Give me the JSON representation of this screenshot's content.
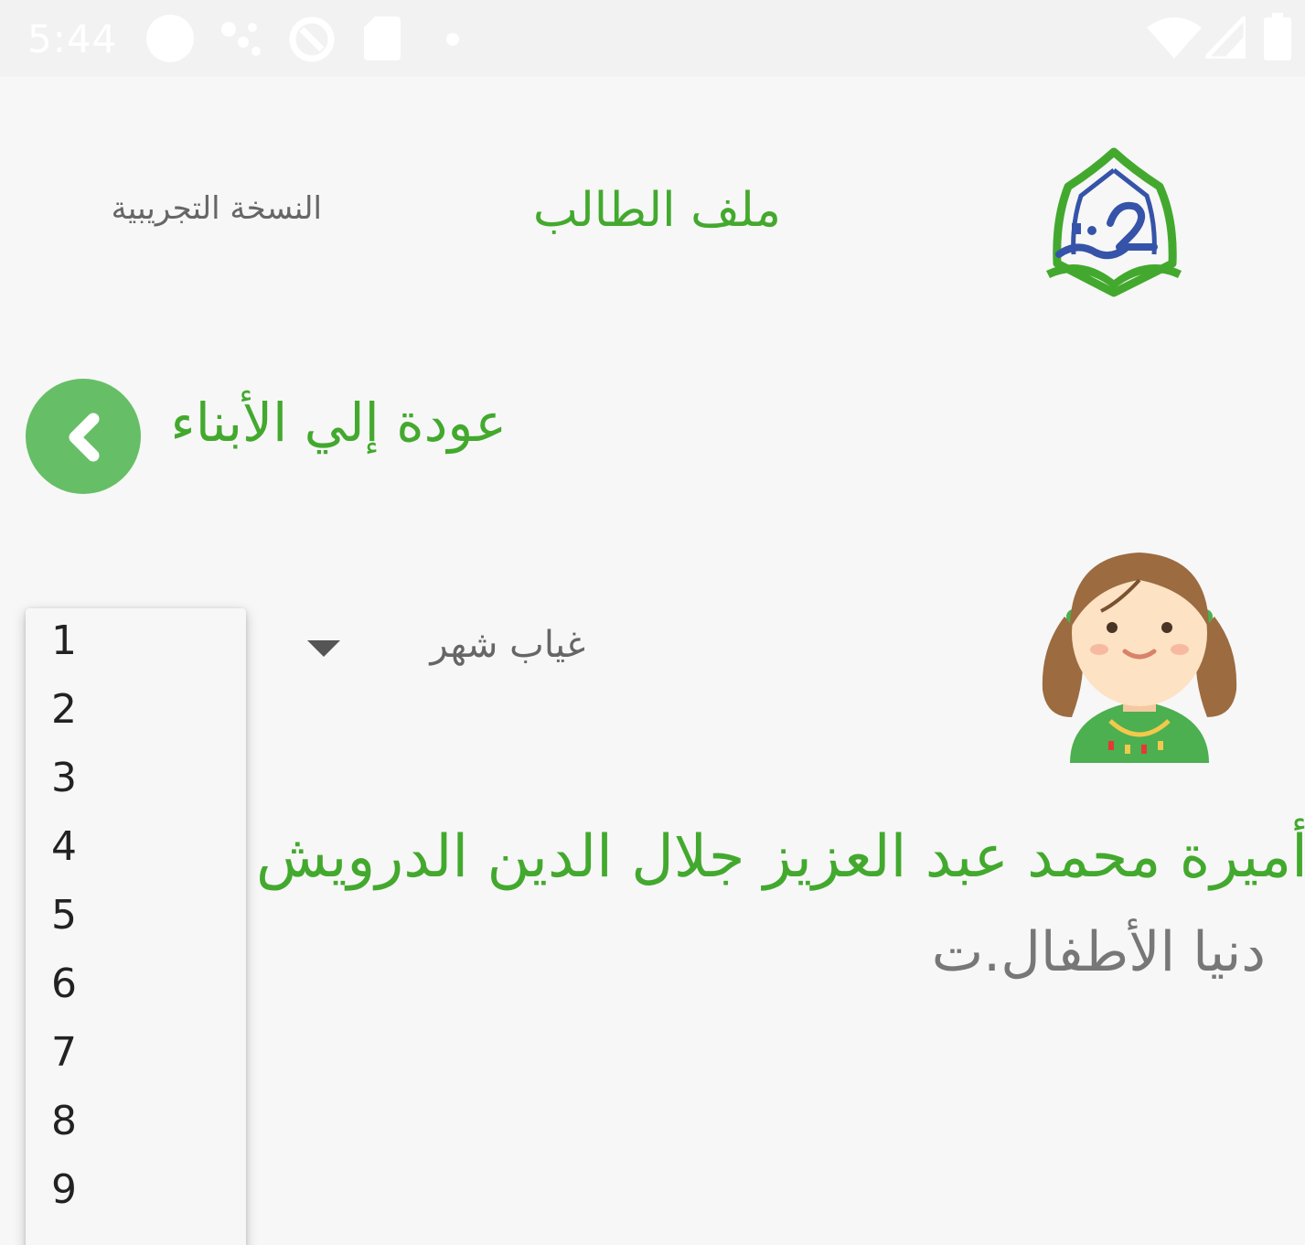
{
  "status_bar": {
    "time": "5:44",
    "icons": [
      "circle-icon",
      "dots-icon",
      "sync-icon",
      "sd-card-icon",
      "dot-icon",
      "wifi-icon",
      "cell-signal-icon",
      "battery-icon"
    ]
  },
  "header": {
    "trial_label": "النسخة التجريبية",
    "title": "ملف الطالب",
    "logo_icon": "kawthar-logo-icon"
  },
  "back": {
    "label": "عودة إلي الأبناء",
    "icon": "chevron-left-icon"
  },
  "absence_select": {
    "selected_label": "غياب شهر",
    "options": [
      "1",
      "2",
      "3",
      "4",
      "5",
      "6",
      "7",
      "8",
      "9"
    ]
  },
  "student": {
    "avatar_icon": "girl-avatar-icon",
    "name": "أميرة محمد عبد العزيز جلال الدين الدرويش",
    "school": "دنيا الأطفال.ت"
  },
  "colors": {
    "accent_green": "#43a92e",
    "button_green": "#66bf66",
    "logo_blue": "#3553a8",
    "background": "#f7f7f7"
  }
}
